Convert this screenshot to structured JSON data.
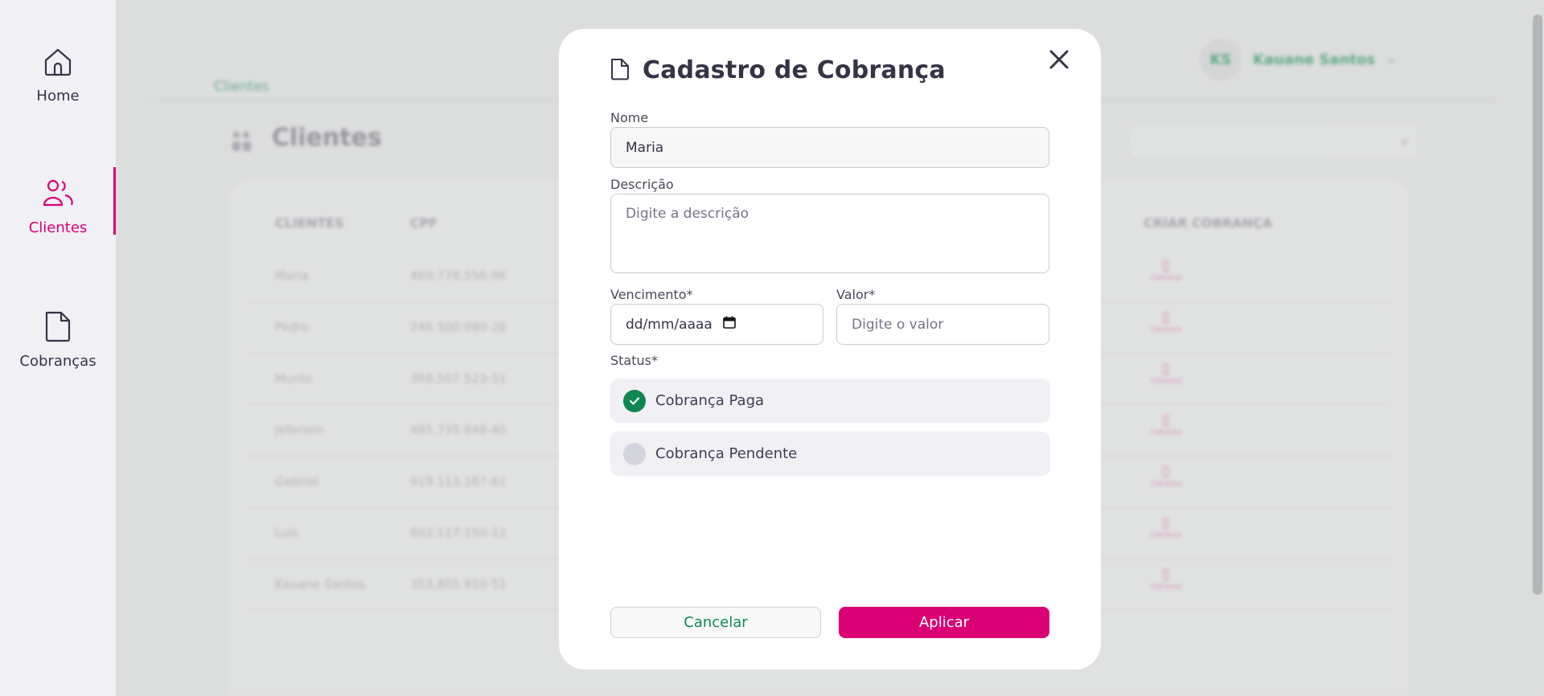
{
  "sidebar": {
    "items": [
      {
        "label": "Home",
        "icon": "home-icon",
        "active": false
      },
      {
        "label": "Clientes",
        "icon": "users-icon",
        "active": true
      },
      {
        "label": "Cobranças",
        "icon": "document-icon",
        "active": false
      }
    ],
    "accent_color": "#da0175"
  },
  "background": {
    "breadcrumb": "Clientes",
    "page_title": "Clientes",
    "user": {
      "initials": "KS",
      "name": "Kauane Santos"
    },
    "table": {
      "headers": [
        "CLIENTES",
        "CPF",
        "CRIAR COBRANÇA"
      ],
      "rows": [
        {
          "name": "Maria",
          "cpf": "469.778.556-96",
          "status_color": "#9fd8bf"
        },
        {
          "name": "Pedro",
          "cpf": "246.500.080-26",
          "status_color": "#e06b9f"
        },
        {
          "name": "Murilo",
          "cpf": "368.507.523-51",
          "status_color": "#e06b9f"
        },
        {
          "name": "Jeferson",
          "cpf": "485.735.848-40",
          "status_color": "#e06b9f"
        },
        {
          "name": "Gabriel",
          "cpf": "919.113.167-61",
          "status_color": "#9fd8bf"
        },
        {
          "name": "Luis",
          "cpf": "802.117.150-12",
          "status_color": "#e06b9f"
        },
        {
          "name": "Kauane Santos",
          "cpf": "353.805.910-51",
          "status_color": "#e06b9f"
        }
      ],
      "cobranca_label": "Cobrança"
    }
  },
  "modal": {
    "title": "Cadastro de Cobrança",
    "title_icon": "document-icon",
    "fields": {
      "nome": {
        "label": "Nome",
        "value": "Maria"
      },
      "descricao": {
        "label": "Descrição",
        "placeholder": "Digite a descrição"
      },
      "vencimento": {
        "label": "Vencimento*",
        "placeholder": "dd/mm/aaaa"
      },
      "valor": {
        "label": "Valor*",
        "placeholder": "Digite o valor"
      }
    },
    "status": {
      "label": "Status*",
      "options": [
        {
          "label": "Cobrança Paga",
          "checked": true
        },
        {
          "label": "Cobrança Pendente",
          "checked": false
        }
      ]
    },
    "buttons": {
      "cancel": "Cancelar",
      "apply": "Aplicar"
    },
    "colors": {
      "primary": "#da0175",
      "success": "#0e8750"
    }
  }
}
